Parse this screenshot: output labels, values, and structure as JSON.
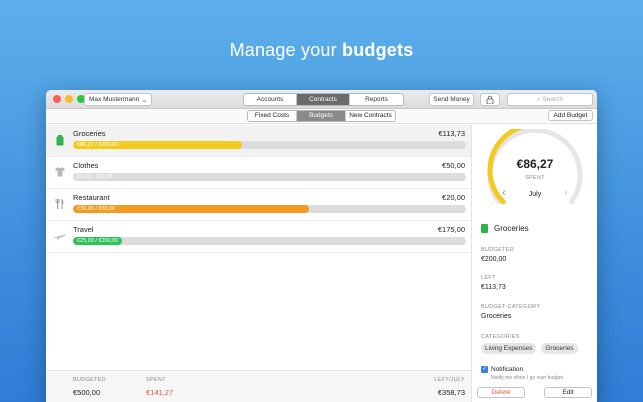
{
  "headline": {
    "regular": "Manage your ",
    "bold": "budgets"
  },
  "toolbar": {
    "user": "Max Mustermann",
    "tabs": [
      "Accounts",
      "Contracts",
      "Reports"
    ],
    "send_money": "Send Money",
    "search_placeholder": "Search"
  },
  "subtoolbar": {
    "tabs": [
      "Fixed Costs",
      "Budgets",
      "New Contracts"
    ],
    "add_budget": "Add Budget"
  },
  "budgets": [
    {
      "name": "Groceries",
      "amount": "€113,73",
      "progress_label": "€86,27 / €200,00",
      "fraction": 0.431,
      "color": "#f3cb1f",
      "icon": "grocery-bag-icon"
    },
    {
      "name": "Clothes",
      "amount": "€50,00",
      "progress_label": "€0,00 / €50,00",
      "fraction": 0.0,
      "color": "#cfcfcf",
      "icon": "shirt-icon"
    },
    {
      "name": "Restaurant",
      "amount": "€20,00",
      "progress_label": "€30,00 / €50,00",
      "fraction": 0.6,
      "color": "#f39a1f",
      "icon": "cutlery-icon"
    },
    {
      "name": "Travel",
      "amount": "€175,00",
      "progress_label": "€25,00 / €200,00",
      "fraction": 0.125,
      "color": "#2ec15a",
      "icon": "airplane-icon"
    }
  ],
  "footer": {
    "budgeted_label": "BUDGETED",
    "budgeted_value": "€500,00",
    "spent_label": "SPENT",
    "spent_value": "€141,27",
    "left_label": "LEFT/JULY",
    "left_value": "€358,73"
  },
  "detail": {
    "gauge_amount": "€86,27",
    "gauge_label": "SPENT",
    "gauge_fraction": 0.431,
    "month": "July",
    "title": "Groceries",
    "budgeted_label": "BUDGETED",
    "budgeted_value": "€200,00",
    "left_label": "LEFT",
    "left_value": "€113,73",
    "category_label": "BUDGET-CATEGORY",
    "category_value": "Groceries",
    "categories_label": "CATEGORIES",
    "categories": [
      "Living Expenses",
      "Groceries"
    ],
    "notification_label": "Notification",
    "notification_sub": "Notify me when I go over budget.",
    "delete_label": "Delete",
    "edit_label": "Edit"
  },
  "colors": {
    "accent": "#f3cb1f",
    "danger": "#e8583a",
    "brand_bg": "#4a9be4"
  }
}
